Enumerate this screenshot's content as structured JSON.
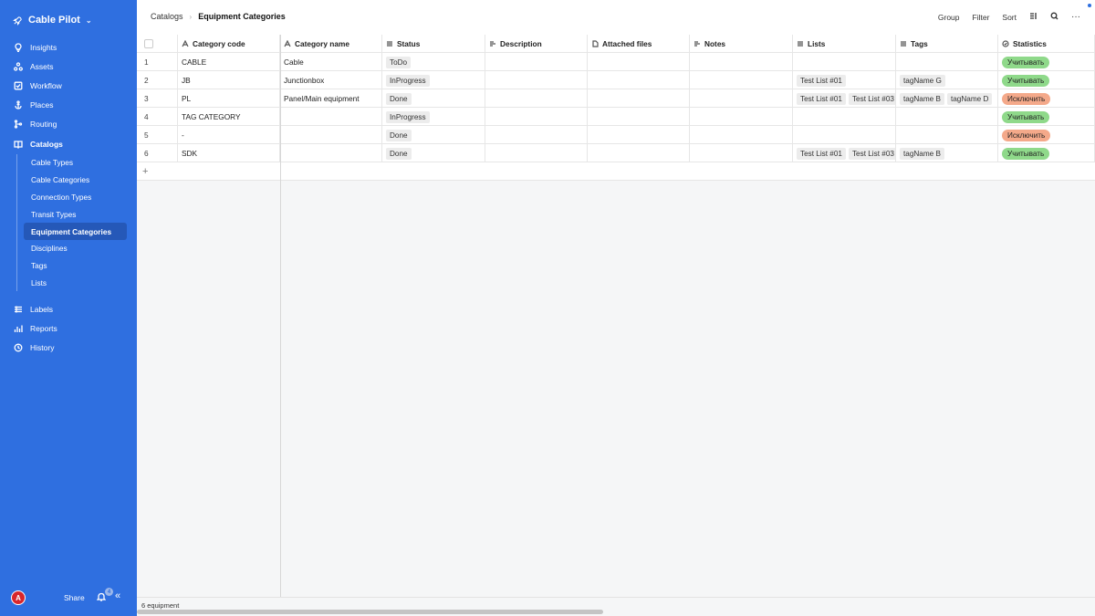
{
  "app": {
    "name": "Cable Pilot"
  },
  "sidebar": {
    "items": [
      {
        "label": "Insights",
        "icon": "lightbulb-icon"
      },
      {
        "label": "Assets",
        "icon": "assets-icon"
      },
      {
        "label": "Workflow",
        "icon": "workflow-icon"
      },
      {
        "label": "Places",
        "icon": "anchor-icon"
      },
      {
        "label": "Routing",
        "icon": "routing-icon"
      },
      {
        "label": "Catalogs",
        "icon": "book-icon"
      }
    ],
    "catalogs": [
      "Cable Types",
      "Cable Categories",
      "Connection Types",
      "Transit Types",
      "Equipment Categories",
      "Disciplines",
      "Tags",
      "Lists"
    ],
    "items2": [
      {
        "label": "Labels",
        "icon": "labels-icon"
      },
      {
        "label": "Reports",
        "icon": "reports-icon"
      },
      {
        "label": "History",
        "icon": "history-icon"
      }
    ],
    "user_initial": "A",
    "share_label": "Share",
    "notification_count": "4"
  },
  "breadcrumb": {
    "parent": "Catalogs",
    "current": "Equipment Categories"
  },
  "toolbar": {
    "group": "Group",
    "filter": "Filter",
    "sort": "Sort"
  },
  "table": {
    "columns": [
      "Category code",
      "Category name",
      "Status",
      "Description",
      "Attached files",
      "Notes",
      "Lists",
      "Tags",
      "Statistics"
    ],
    "rows": [
      {
        "n": "1",
        "code": "CABLE",
        "name": "Cable",
        "status": "ToDo",
        "lists": [],
        "tags": [],
        "stat": "Учитывать",
        "stat_type": "include"
      },
      {
        "n": "2",
        "code": "JB",
        "name": "Junctionbox",
        "status": "InProgress",
        "lists": [
          "Test List #01"
        ],
        "tags": [
          "tagName G"
        ],
        "stat": "Учитывать",
        "stat_type": "include"
      },
      {
        "n": "3",
        "code": "PL",
        "name": "Panel/Main equipment",
        "status": "Done",
        "lists": [
          "Test List #01",
          "Test List #03"
        ],
        "tags": [
          "tagName B",
          "tagName D"
        ],
        "stat": "Исключить",
        "stat_type": "exclude"
      },
      {
        "n": "4",
        "code": "TAG CATEGORY",
        "name": "",
        "status": "InProgress",
        "lists": [],
        "tags": [],
        "stat": "Учитывать",
        "stat_type": "include"
      },
      {
        "n": "5",
        "code": "-",
        "name": "",
        "status": "Done",
        "lists": [],
        "tags": [],
        "stat": "Исключить",
        "stat_type": "exclude"
      },
      {
        "n": "6",
        "code": "SDK",
        "name": "",
        "status": "Done",
        "lists": [
          "Test List #01",
          "Test List #03"
        ],
        "tags": [
          "tagName B"
        ],
        "stat": "Учитывать",
        "stat_type": "include"
      }
    ]
  },
  "footer": {
    "count": "6 equipment"
  },
  "colors": {
    "sidebar": "#2f6fe0",
    "include": "#8fd98a",
    "exclude": "#f4a98a",
    "active": "#2558b8"
  }
}
